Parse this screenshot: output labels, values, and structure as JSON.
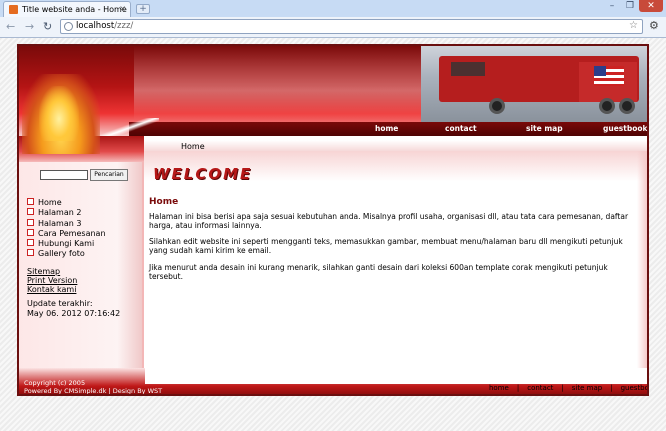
{
  "browser": {
    "tab_title": "Title website anda - Home",
    "new_tab": "+",
    "url_host": "localhost",
    "url_path": "/zzz/",
    "win_min": "–",
    "win_max": "❐",
    "win_close": "✕",
    "tab_close": "×",
    "back": "←",
    "forward": "→",
    "reload": "↻",
    "star": "☆",
    "wrench": "🔧"
  },
  "site": {
    "topnav": [
      "home",
      "contact",
      "site map",
      "guestbook"
    ],
    "breadcrumb": "Home",
    "search": {
      "placeholder": "",
      "button": "Pencarian"
    },
    "menu": [
      "Home",
      "Halaman 2",
      "Halaman 3",
      "Cara Pemesanan",
      "Hubungi Kami",
      "Gallery foto"
    ],
    "extra_links": [
      "Sitemap",
      "Print Version",
      "Kontak kami"
    ],
    "update_label": "Update terakhir:",
    "update_date": "May 06. 2012 07:16:42",
    "welcome": "WELCOME",
    "content": {
      "title": "Home",
      "paragraphs": [
        "Halaman ini bisa berisi apa saja sesuai kebutuhan anda. Misalnya profil usaha, organisasi dll, atau tata cara pemesanan, daftar harga, atau informasi lainnya.",
        "Silahkan edit website ini seperti mengganti teks, memasukkan gambar, membuat menu/halaman baru dll mengikuti petunjuk yang sudah kami kirim ke email.",
        "Jika menurut anda desain ini kurang menarik, silahkan ganti desain dari koleksi 600an template corak mengikuti petunjuk tersebut."
      ]
    },
    "footer": {
      "copyright_line1": "Copyright (c) 2005",
      "copyright_line2": "Powered By CMSimple.dk | Design By WST",
      "nav": [
        "home",
        "contact",
        "site map",
        "guestbook"
      ],
      "separator": "|"
    }
  },
  "colors": {
    "accent": "#b51818",
    "dark_red": "#6a0f0f"
  }
}
